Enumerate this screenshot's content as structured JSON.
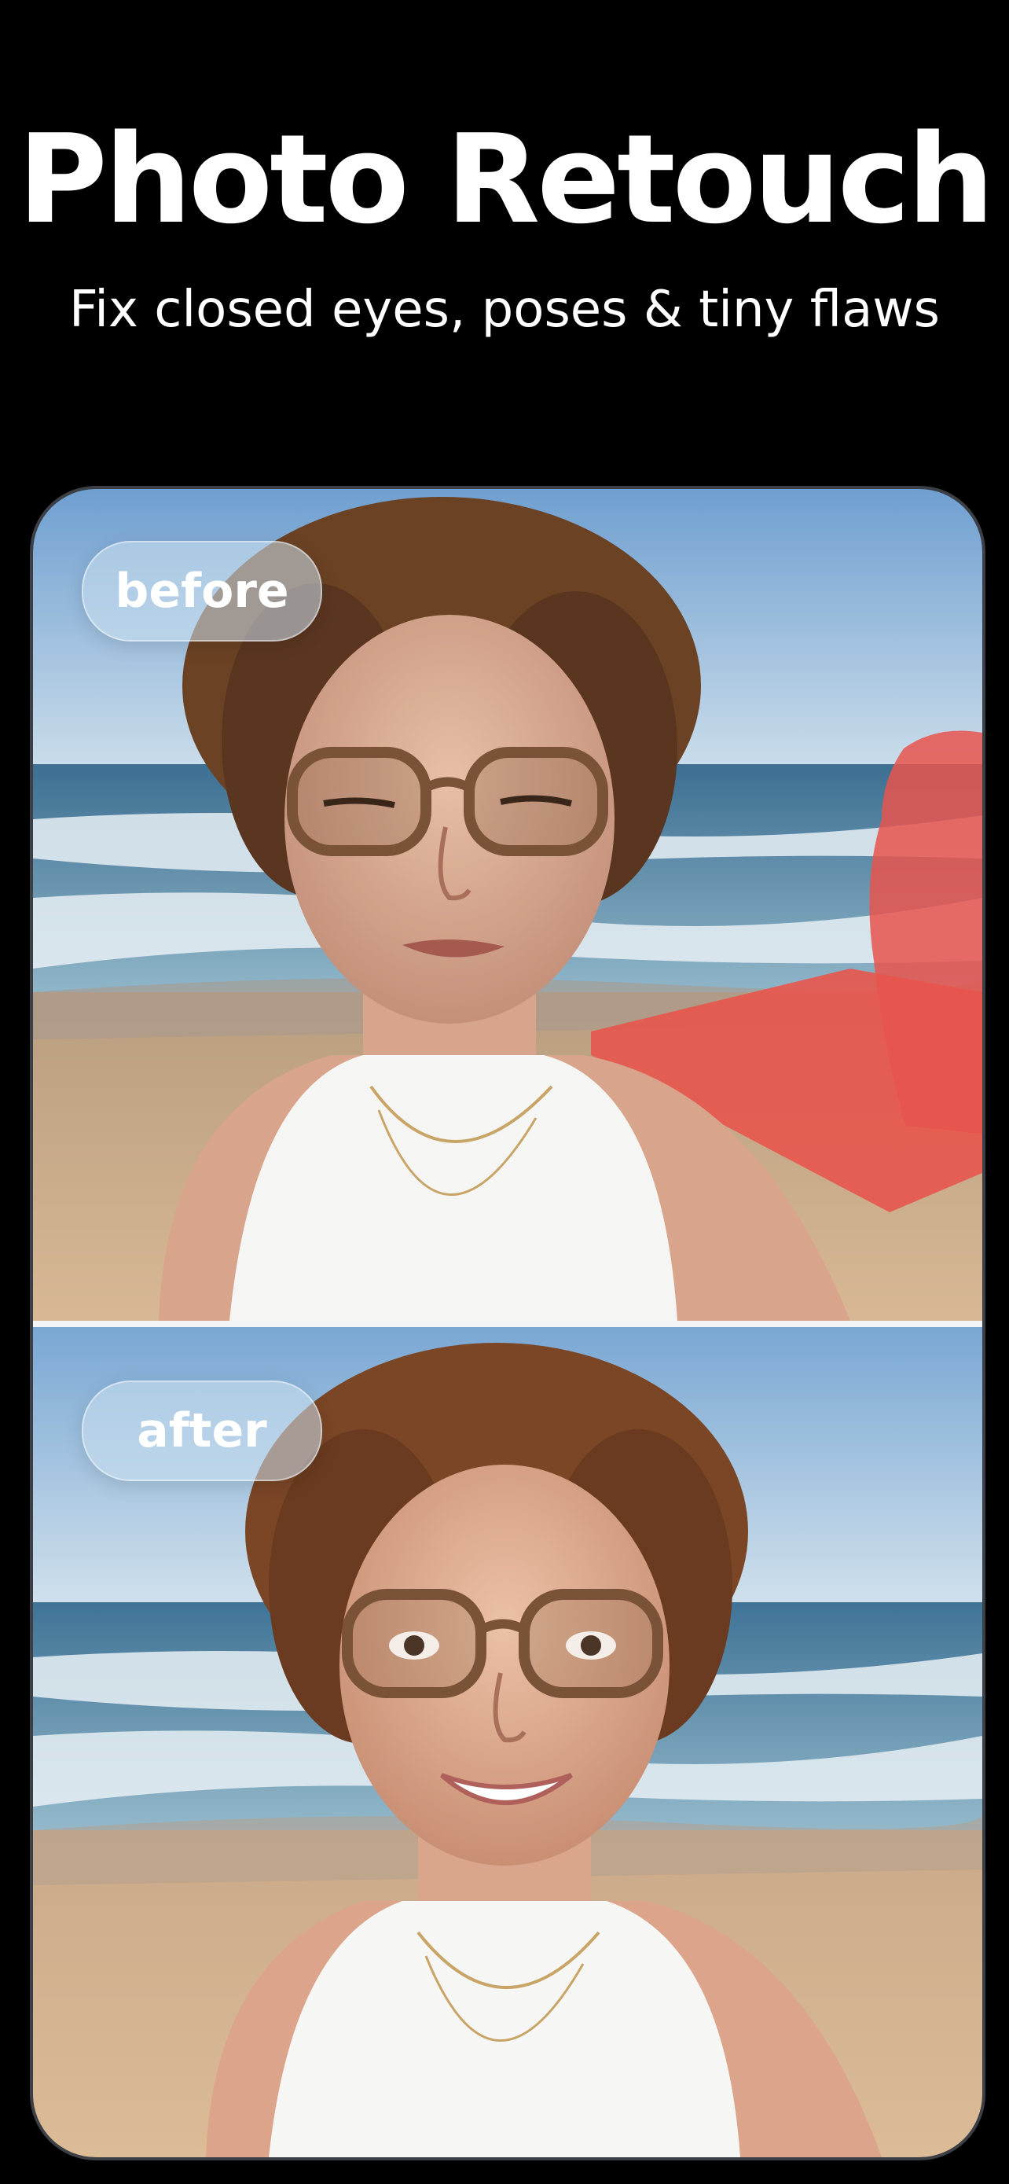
{
  "header": {
    "title": "Photo Retouch",
    "subtitle": "Fix closed eyes, poses & tiny flaws"
  },
  "comparison": {
    "before_label": "before",
    "after_label": "after"
  },
  "colors": {
    "background": "#000000",
    "highlight_mask": "#e8554d",
    "badge": "#cde1f0"
  }
}
